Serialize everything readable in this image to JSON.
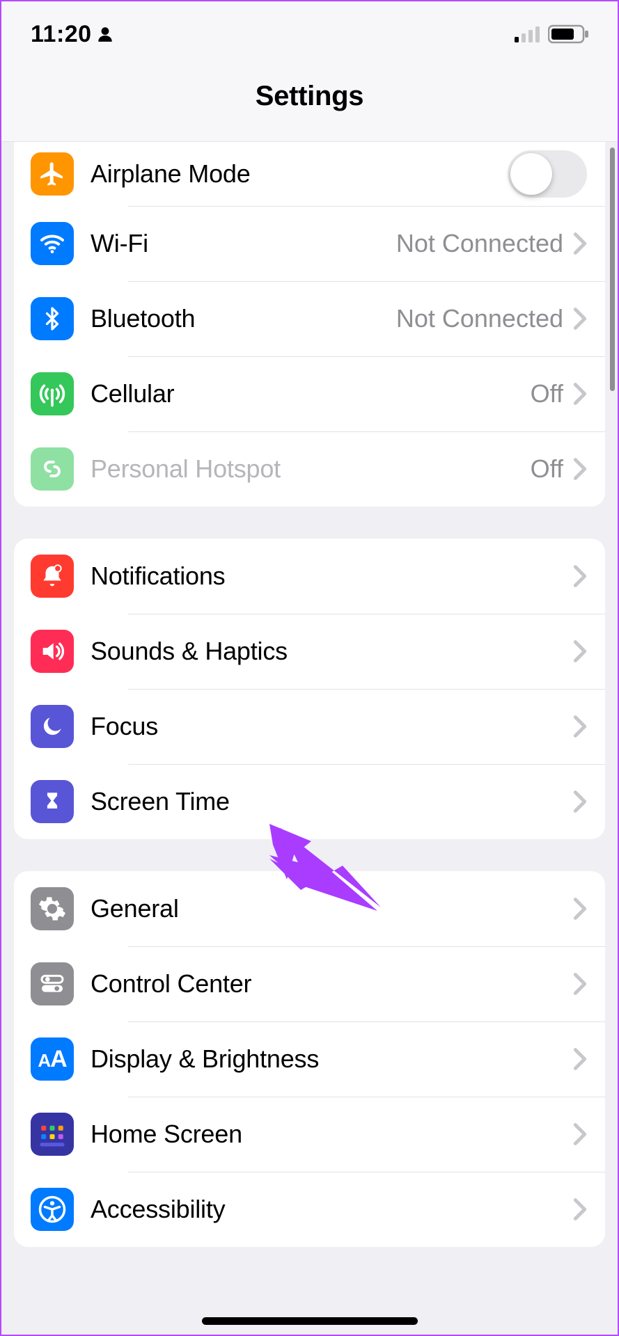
{
  "status": {
    "time": "11:20"
  },
  "header": {
    "title": "Settings"
  },
  "groups": [
    {
      "items": [
        {
          "key": "airplane",
          "label": "Airplane Mode",
          "icon": "airplane-icon",
          "color": "#ff9500",
          "control": "switch",
          "switch_on": false
        },
        {
          "key": "wifi",
          "label": "Wi-Fi",
          "icon": "wifi-icon",
          "color": "#007aff",
          "value": "Not Connected"
        },
        {
          "key": "bt",
          "label": "Bluetooth",
          "icon": "bluetooth-icon",
          "color": "#007aff",
          "value": "Not Connected"
        },
        {
          "key": "cell",
          "label": "Cellular",
          "icon": "antenna-icon",
          "color": "#34c759",
          "value": "Off"
        },
        {
          "key": "hotspot",
          "label": "Personal Hotspot",
          "icon": "link-icon",
          "color": "#34c759",
          "value": "Off",
          "disabled": true
        }
      ]
    },
    {
      "items": [
        {
          "key": "notifications",
          "label": "Notifications",
          "icon": "bell-icon",
          "color": "#ff3b30"
        },
        {
          "key": "sounds",
          "label": "Sounds & Haptics",
          "icon": "speaker-icon",
          "color": "#ff2d55"
        },
        {
          "key": "focus",
          "label": "Focus",
          "icon": "moon-icon",
          "color": "#5856d6"
        },
        {
          "key": "screentime",
          "label": "Screen Time",
          "icon": "hourglass-icon",
          "color": "#5856d6"
        }
      ]
    },
    {
      "items": [
        {
          "key": "general",
          "label": "General",
          "icon": "gear-icon",
          "color": "#8e8e93"
        },
        {
          "key": "control",
          "label": "Control Center",
          "icon": "switches-icon",
          "color": "#8e8e93"
        },
        {
          "key": "display",
          "label": "Display & Brightness",
          "icon": "aa-icon",
          "color": "#007aff"
        },
        {
          "key": "home",
          "label": "Home Screen",
          "icon": "grid-icon",
          "color": "#3634a3"
        },
        {
          "key": "access",
          "label": "Accessibility",
          "icon": "person-icon",
          "color": "#007aff"
        }
      ]
    }
  ],
  "annotation": {
    "arrow_color": "#a93cff"
  }
}
